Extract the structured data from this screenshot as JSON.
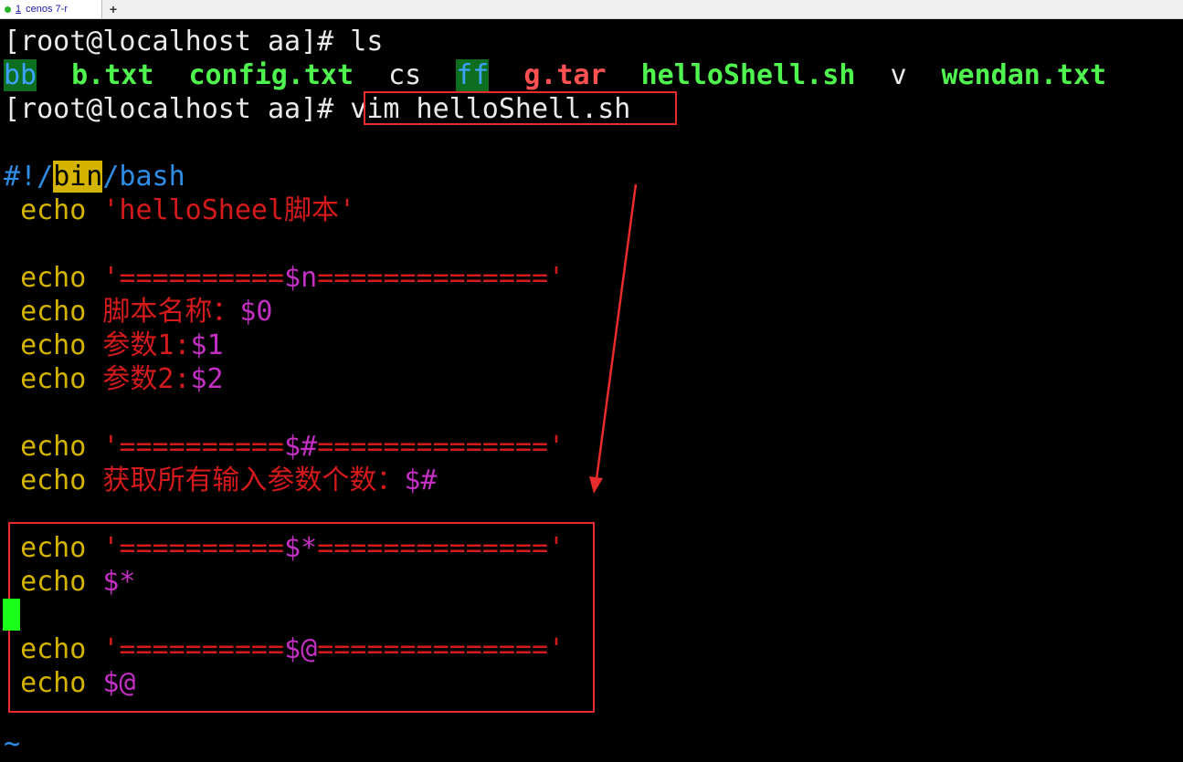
{
  "tab": {
    "number": "1",
    "label": "cenos 7-r",
    "add_label": "+"
  },
  "shell": {
    "prompt": "[root@localhost aa]# ",
    "cmd1": "ls",
    "cmd2": "vim helloShell.sh"
  },
  "ls_output": {
    "bb": "bb",
    "b_txt": "b.txt",
    "config_txt": "config.txt",
    "cs": "cs",
    "ff": "ff",
    "g_tar": "g.tar",
    "hello_sh": "helloShell.sh",
    "v": "v",
    "wendan_txt": "wendan.txt"
  },
  "script": {
    "shebang_a": "#!/",
    "shebang_b": "bin",
    "shebang_c": "/bash",
    "echo": "echo",
    "l2": "'helloSheel脚本'",
    "l4_a": "'==========",
    "l4_b": "$n",
    "l4_c": "=============='",
    "l5_a": "脚本名称：",
    "l5_b": "$0",
    "l6_a": "参数1:",
    "l6_b": "$1",
    "l7_a": "参数2:",
    "l7_b": "$2",
    "l9_a": "'==========",
    "l9_b": "$#",
    "l9_c": "=============='",
    "l10_a": "获取所有输入参数个数：",
    "l10_b": "$#",
    "l12_a": "'==========",
    "l12_b": "$*",
    "l12_c": "=============='",
    "l13_b": "$*",
    "l15_a": "'==========",
    "l15_b": "$@",
    "l15_c": "=============='",
    "l16_b": "$@",
    "tilde": "~"
  },
  "colors": {
    "annotation": "#e82b2b",
    "cursor": "#1aff1a",
    "keyword": "#d4b400",
    "string": "#d41a1a",
    "variable": "#c22fc2"
  }
}
